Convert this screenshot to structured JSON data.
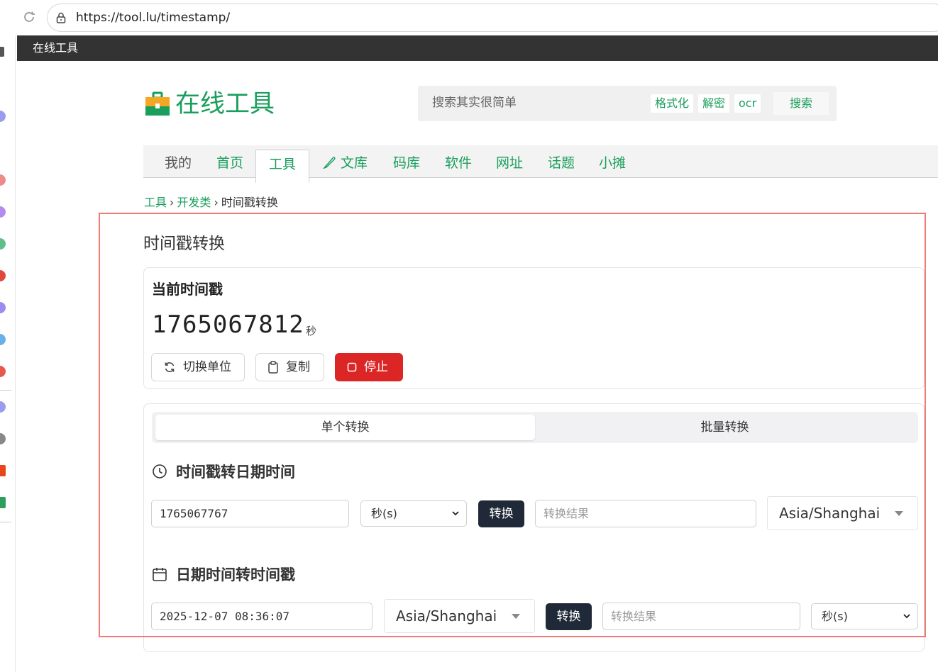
{
  "browser": {
    "url": "https://tool.lu/timestamp/"
  },
  "site_bar": {
    "title": "在线工具"
  },
  "header": {
    "brand": "在线工具",
    "search_placeholder": "搜索其实很简单",
    "tags": [
      "格式化",
      "解密",
      "ocr"
    ],
    "search_button": "搜索"
  },
  "nav": {
    "items": [
      "我的",
      "首页",
      "工具",
      "文库",
      "码库",
      "软件",
      "网址",
      "话题",
      "小摊"
    ],
    "active": "工具"
  },
  "breadcrumb": {
    "items": [
      "工具",
      "开发类",
      "时间戳转换"
    ],
    "separator": "›"
  },
  "page": {
    "title": "时间戳转换"
  },
  "current": {
    "title": "当前时间戳",
    "value": "1765067812",
    "unit": "秒",
    "buttons": {
      "switch_unit": "切换单位",
      "copy": "复制",
      "stop": "停止"
    }
  },
  "converter": {
    "tabs": [
      "单个转换",
      "批量转换"
    ],
    "active_tab": "单个转换",
    "ts_to_date": {
      "title": "时间戳转日期时间",
      "input_value": "1765067767",
      "unit_selected": "秒(s)",
      "convert_button": "转换",
      "result_placeholder": "转换结果",
      "timezone": "Asia/Shanghai"
    },
    "date_to_ts": {
      "title": "日期时间转时间戳",
      "input_value": "2025-12-07 08:36:07",
      "timezone": "Asia/Shanghai",
      "convert_button": "转换",
      "result_placeholder": "转换结果",
      "unit_selected": "秒(s)"
    }
  },
  "colors": {
    "brand_green": "#1a9e5c",
    "stop_red": "#dc2626",
    "dark_button": "#1f2937",
    "highlight_border": "#f07a74"
  }
}
